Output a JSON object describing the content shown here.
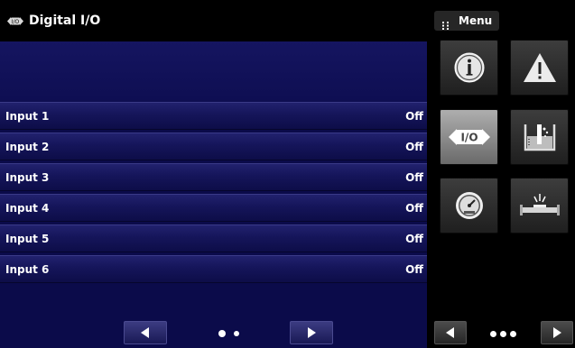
{
  "header": {
    "title": "Digital I/O"
  },
  "menu": {
    "label": "Menu",
    "tiles": [
      {
        "icon": "info-icon"
      },
      {
        "icon": "warning-icon"
      },
      {
        "icon": "digital-io-icon",
        "text": "I/O",
        "active": true
      },
      {
        "icon": "leak-test-icon"
      },
      {
        "icon": "gauge-icon"
      },
      {
        "icon": "balance-icon"
      }
    ],
    "pager": {
      "dots": 3,
      "current": 1
    }
  },
  "inputs": [
    {
      "label": "Input 1",
      "value": "Off"
    },
    {
      "label": "Input 2",
      "value": "Off"
    },
    {
      "label": "Input 3",
      "value": "Off"
    },
    {
      "label": "Input 4",
      "value": "Off"
    },
    {
      "label": "Input 5",
      "value": "Off"
    },
    {
      "label": "Input 6",
      "value": "Off"
    }
  ],
  "pager": {
    "dots": 2,
    "current": 1
  },
  "colors": {
    "panel": "#0b0b4a",
    "row": "#15155a",
    "tile": "#2d2d2d",
    "tile_active": "#8a8a8a"
  }
}
